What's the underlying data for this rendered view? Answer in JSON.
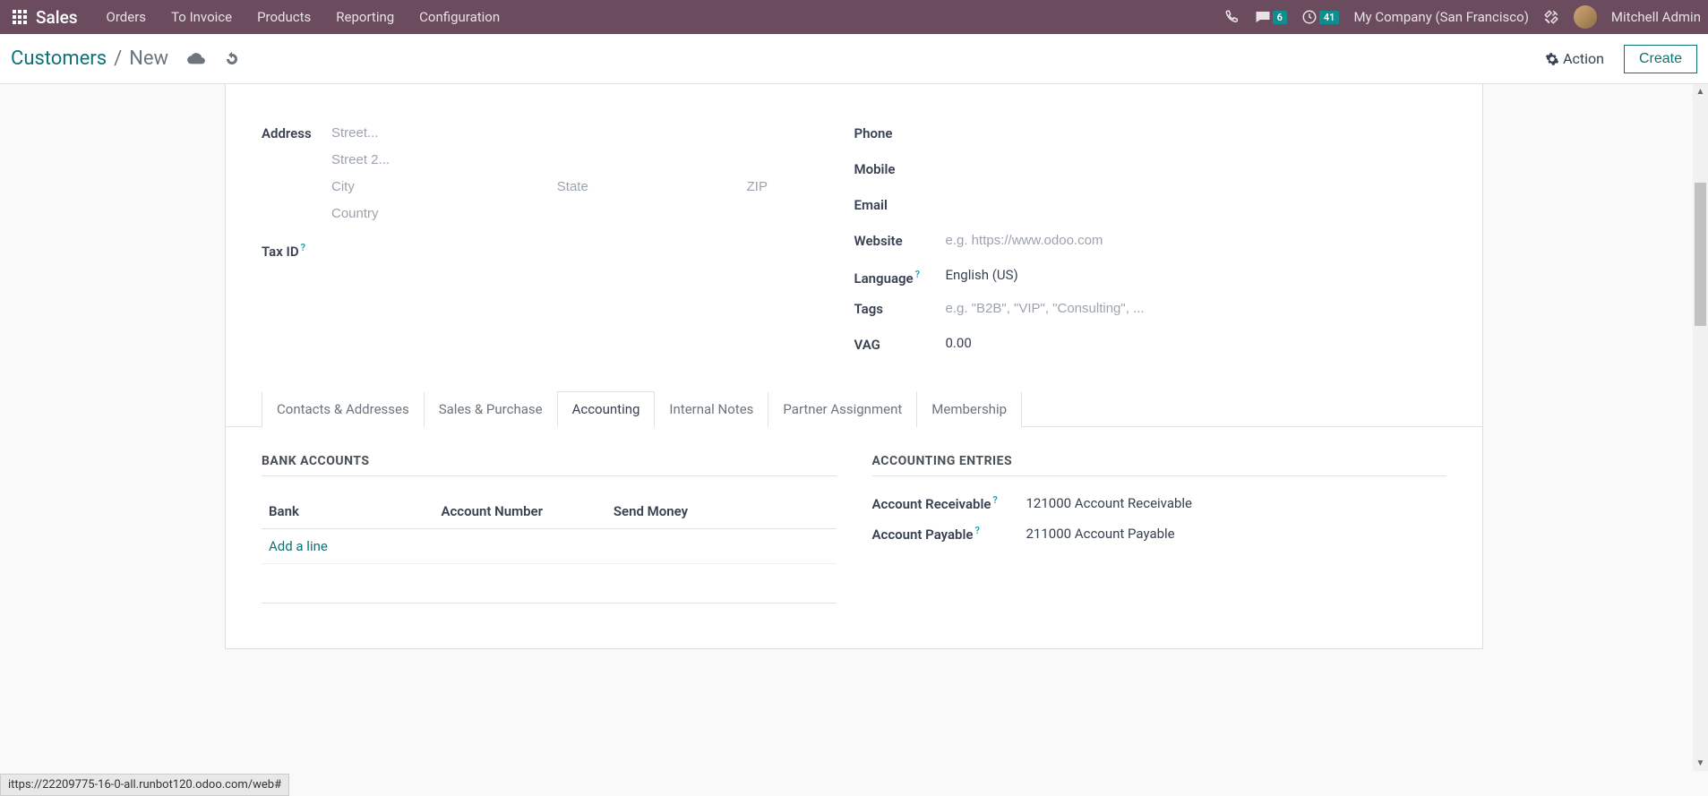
{
  "topbar": {
    "brand": "Sales",
    "menu": [
      "Orders",
      "To Invoice",
      "Products",
      "Reporting",
      "Configuration"
    ],
    "msg_badge": "6",
    "clock_badge": "41",
    "company": "My Company (San Francisco)",
    "user": "Mitchell Admin"
  },
  "breadcrumb": {
    "root": "Customers",
    "sep": "/",
    "current": "New",
    "action_label": "Action",
    "create_label": "Create"
  },
  "form": {
    "address": {
      "label": "Address",
      "street_ph": "Street...",
      "street2_ph": "Street 2...",
      "city_ph": "City",
      "state_ph": "State",
      "zip_ph": "ZIP",
      "country_ph": "Country"
    },
    "taxid_label": "Tax ID",
    "phone_label": "Phone",
    "mobile_label": "Mobile",
    "email_label": "Email",
    "website_label": "Website",
    "website_ph": "e.g. https://www.odoo.com",
    "language_label": "Language",
    "language_value": "English (US)",
    "tags_label": "Tags",
    "tags_ph": "e.g. \"B2B\", \"VIP\", \"Consulting\", ...",
    "vag_label": "VAG",
    "vag_value": "0.00"
  },
  "tabs": [
    "Contacts & Addresses",
    "Sales & Purchase",
    "Accounting",
    "Internal Notes",
    "Partner Assignment",
    "Membership"
  ],
  "active_tab": 2,
  "bank": {
    "section": "BANK ACCOUNTS",
    "cols": [
      "Bank",
      "Account Number",
      "Send Money"
    ],
    "add_line": "Add a line"
  },
  "entries": {
    "section": "ACCOUNTING ENTRIES",
    "receivable_label": "Account Receivable",
    "receivable_value": "121000 Account Receivable",
    "payable_label": "Account Payable",
    "payable_value": "211000 Account Payable"
  },
  "status_url": "ittps://22209775-16-0-all.runbot120.odoo.com/web#"
}
